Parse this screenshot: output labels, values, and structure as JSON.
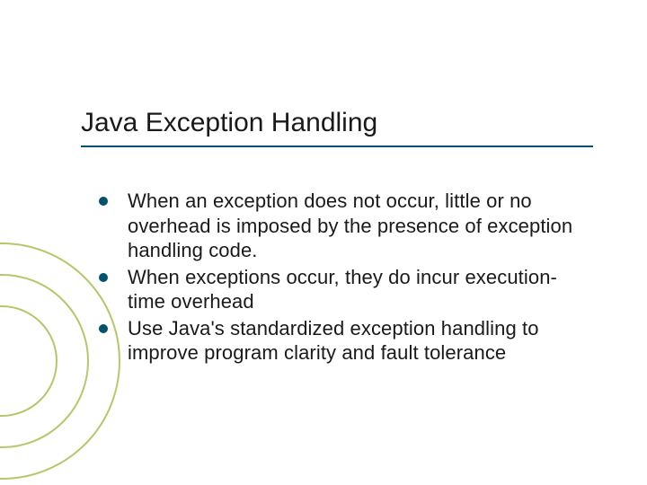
{
  "title": "Java Exception Handling",
  "bullets": [
    "When an exception does not occur, little or no overhead is imposed by the presence of exception handling code.",
    "When exceptions occur, they do incur execution-time overhead",
    "Use Java's standardized exception handling to improve program clarity and fault tolerance"
  ]
}
